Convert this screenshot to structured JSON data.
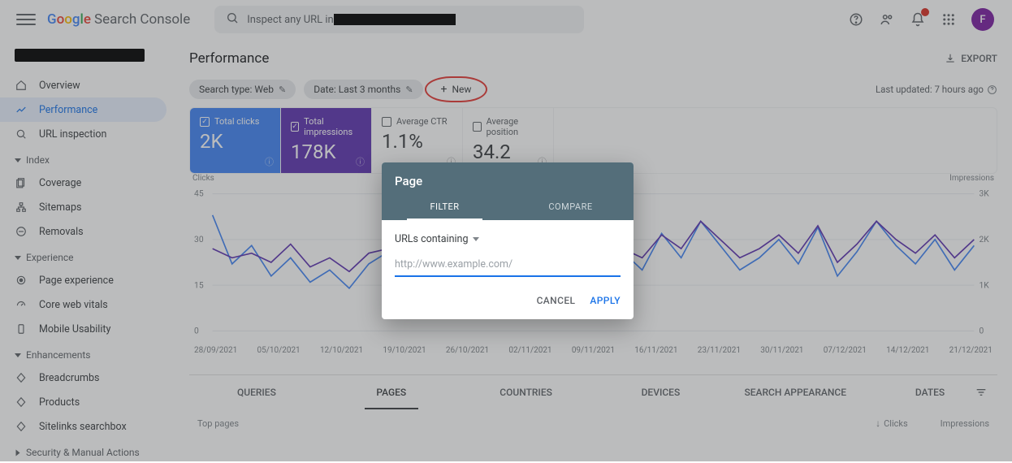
{
  "header": {
    "logo_text": "Google",
    "product": "Search Console",
    "search_prefix": "Inspect any URL in",
    "avatar_letter": "F"
  },
  "sidebar": {
    "items": [
      {
        "label": "Overview",
        "icon": "home"
      },
      {
        "label": "Performance",
        "icon": "trend",
        "active": true
      },
      {
        "label": "URL inspection",
        "icon": "search"
      }
    ],
    "groups": [
      {
        "label": "Index",
        "items": [
          {
            "label": "Coverage",
            "icon": "pages"
          },
          {
            "label": "Sitemaps",
            "icon": "sitemap"
          },
          {
            "label": "Removals",
            "icon": "removal"
          }
        ]
      },
      {
        "label": "Experience",
        "items": [
          {
            "label": "Page experience",
            "icon": "circle"
          },
          {
            "label": "Core web vitals",
            "icon": "speed"
          },
          {
            "label": "Mobile Usability",
            "icon": "phone"
          }
        ]
      },
      {
        "label": "Enhancements",
        "items": [
          {
            "label": "Breadcrumbs",
            "icon": "diamond"
          },
          {
            "label": "Products",
            "icon": "diamond"
          },
          {
            "label": "Sitelinks searchbox",
            "icon": "diamond"
          }
        ]
      },
      {
        "label": "Security & Manual Actions",
        "items": []
      }
    ]
  },
  "page": {
    "title": "Performance",
    "export": "EXPORT",
    "chips": [
      {
        "label": "Search type: Web",
        "editable": true
      },
      {
        "label": "Date: Last 3 months",
        "editable": true
      }
    ],
    "new_label": "New",
    "last_updated": "Last updated: 7 hours ago"
  },
  "metrics": {
    "clicks": {
      "label": "Total clicks",
      "value": "2K",
      "checked": true
    },
    "impressions": {
      "label": "Total impressions",
      "value": "178K",
      "checked": true
    },
    "ctr": {
      "label": "Average CTR",
      "value": "1.1%",
      "checked": false
    },
    "position": {
      "label": "Average position",
      "value": "34.2",
      "checked": false
    }
  },
  "chart": {
    "left_axis_label": "Clicks",
    "right_axis_label": "Impressions",
    "left_ticks": [
      "45",
      "30",
      "15",
      "0"
    ],
    "right_ticks": [
      "3K",
      "2K",
      "1K",
      "0"
    ],
    "x_labels": [
      "28/09/2021",
      "05/10/2021",
      "12/10/2021",
      "19/10/2021",
      "26/10/2021",
      "02/11/2021",
      "09/11/2021",
      "16/11/2021",
      "23/11/2021",
      "30/11/2021",
      "07/12/2021",
      "14/12/2021",
      "21/12/2021"
    ]
  },
  "chart_data": {
    "type": "line",
    "x": [
      "28/09/2021",
      "05/10/2021",
      "12/10/2021",
      "19/10/2021",
      "26/10/2021",
      "02/11/2021",
      "09/11/2021",
      "16/11/2021",
      "23/11/2021",
      "30/11/2021",
      "07/12/2021",
      "14/12/2021",
      "21/12/2021"
    ],
    "series": [
      {
        "name": "Clicks",
        "axis": "left",
        "color": "#4285F4",
        "values": [
          38,
          22,
          28,
          18,
          24,
          16,
          20,
          14,
          22,
          26,
          24,
          30,
          20,
          26,
          18,
          22,
          12,
          24,
          30,
          34,
          18,
          26,
          20,
          32,
          24,
          36,
          28,
          20,
          24,
          30,
          22,
          34,
          18,
          26,
          36,
          28,
          22,
          30,
          20,
          28
        ]
      },
      {
        "name": "Impressions",
        "axis": "right",
        "color": "#5e35b1",
        "values": [
          1800,
          1600,
          1700,
          1500,
          1900,
          1400,
          1600,
          1300,
          1700,
          1800,
          1600,
          1900,
          1500,
          1800,
          1400,
          1700,
          1200,
          1800,
          2000,
          2200,
          1400,
          1800,
          1600,
          2100,
          1800,
          2400,
          2000,
          1600,
          1800,
          2100,
          1700,
          2300,
          1500,
          1900,
          2400,
          2000,
          1700,
          2100,
          1600,
          2000
        ]
      }
    ],
    "left_ylim": [
      0,
      45
    ],
    "right_ylim": [
      0,
      3000
    ],
    "xlabel": "",
    "ylabel_left": "Clicks",
    "ylabel_right": "Impressions"
  },
  "tabs": [
    "QUERIES",
    "PAGES",
    "COUNTRIES",
    "DEVICES",
    "SEARCH APPEARANCE",
    "DATES"
  ],
  "tabs_active": 1,
  "table": {
    "head_label": "Top pages",
    "col_clicks": "Clicks",
    "col_impressions": "Impressions"
  },
  "modal": {
    "title": "Page",
    "tabs": [
      "FILTER",
      "COMPARE"
    ],
    "tabs_active": 0,
    "select_label": "URLs containing",
    "placeholder": "http://www.example.com/",
    "cancel": "CANCEL",
    "apply": "APPLY"
  }
}
